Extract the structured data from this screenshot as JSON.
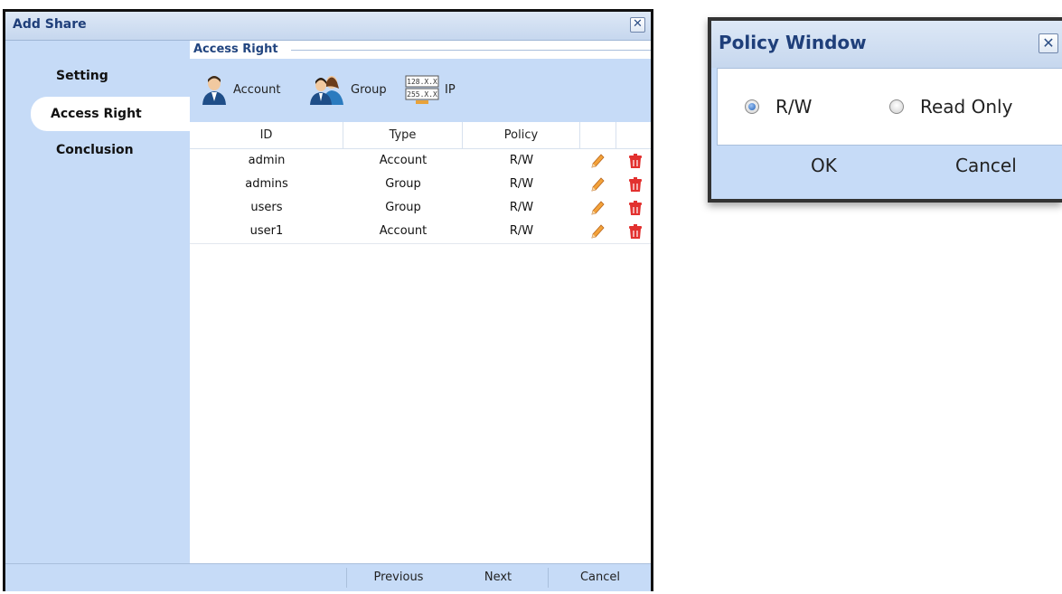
{
  "add_share": {
    "title": "Add Share",
    "close_glyph": "✕",
    "nav": [
      "Setting",
      "Access Right",
      "Conclusion"
    ],
    "section_title": "Access Right",
    "toolbar": {
      "account": "Account",
      "group": "Group",
      "ip": "IP",
      "ip_icon_line1": "128.X.X",
      "ip_icon_line2": "255.X.X"
    },
    "columns": [
      "ID",
      "Type",
      "Policy"
    ],
    "rows": [
      {
        "id": "admin",
        "type": "Account",
        "policy": "R/W"
      },
      {
        "id": "admins",
        "type": "Group",
        "policy": "R/W"
      },
      {
        "id": "users",
        "type": "Group",
        "policy": "R/W"
      },
      {
        "id": "user1",
        "type": "Account",
        "policy": "R/W"
      }
    ],
    "footer": {
      "previous": "Previous",
      "next": "Next",
      "cancel": "Cancel"
    }
  },
  "policy_window": {
    "title": "Policy Window",
    "close_glyph": "✕",
    "options": [
      {
        "label": "R/W",
        "selected": true
      },
      {
        "label": "Read Only",
        "selected": false
      }
    ],
    "ok": "OK",
    "cancel": "Cancel"
  },
  "icons": {
    "account": "user-icon",
    "group": "group-icon",
    "ip": "ip-address-icon",
    "edit": "pencil-icon",
    "delete": "trash-icon"
  },
  "colors": {
    "panel_blue": "#c6dbf7",
    "title_text": "#1f3f7a"
  }
}
